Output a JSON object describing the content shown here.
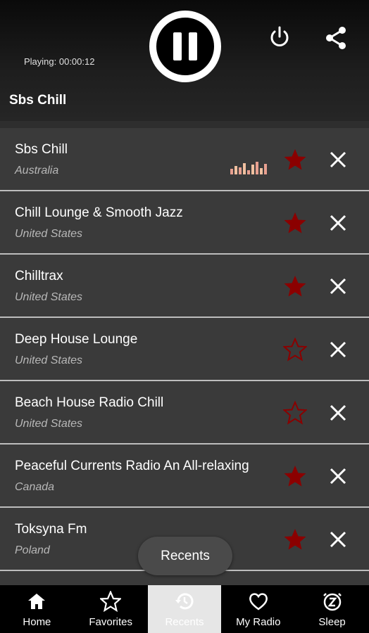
{
  "header": {
    "playing_text": "Playing: 00:00:12",
    "current_station": "Sbs Chill"
  },
  "stations": [
    {
      "name": "Sbs Chill",
      "country": "Australia",
      "favorite": true,
      "now_playing": true
    },
    {
      "name": "Chill Lounge & Smooth Jazz",
      "country": "United States",
      "favorite": true
    },
    {
      "name": "Chilltrax",
      "country": "United States",
      "favorite": true
    },
    {
      "name": "Deep House Lounge",
      "country": "United States",
      "favorite": false
    },
    {
      "name": "Beach House Radio Chill",
      "country": "United States",
      "favorite": false
    },
    {
      "name": "Peaceful Currents Radio An All-relaxing",
      "country": "Canada",
      "favorite": true
    },
    {
      "name": "Toksyna Fm",
      "country": "Poland",
      "favorite": true
    }
  ],
  "toast": "Recents",
  "nav": [
    {
      "label": "Home",
      "icon": "home-icon"
    },
    {
      "label": "Favorites",
      "icon": "star-outline-icon"
    },
    {
      "label": "Recents",
      "icon": "history-icon",
      "active": true
    },
    {
      "label": "My Radio",
      "icon": "heart-icon"
    },
    {
      "label": "Sleep",
      "icon": "sleep-timer-icon"
    }
  ],
  "colors": {
    "favorite_star": "#8b0000",
    "background": "#3a3a3a",
    "header": "#111111"
  }
}
